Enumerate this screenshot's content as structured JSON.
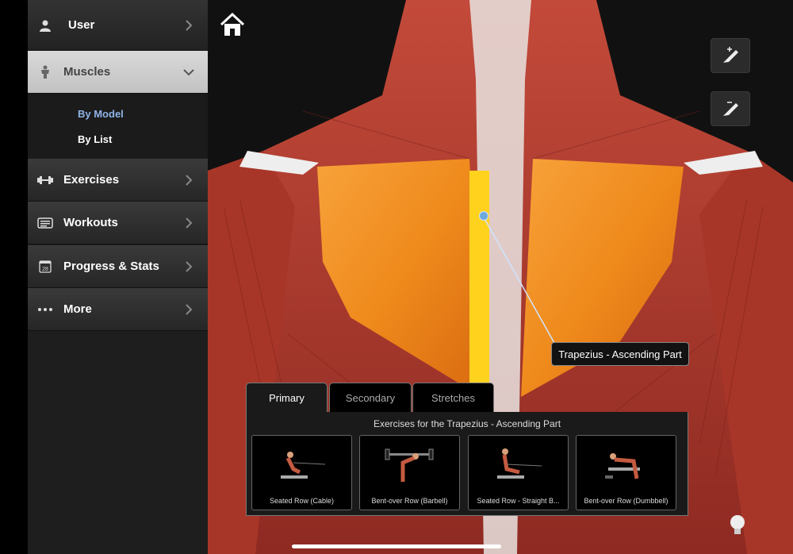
{
  "sidebar": {
    "items": [
      {
        "label": "User",
        "icon": "user-icon"
      },
      {
        "label": "Muscles",
        "icon": "muscle-figure-icon",
        "expanded": true
      },
      {
        "label": "Exercises",
        "icon": "dumbbell-icon"
      },
      {
        "label": "Workouts",
        "icon": "workout-card-icon"
      },
      {
        "label": "Progress & Stats",
        "icon": "calendar-icon"
      },
      {
        "label": "More",
        "icon": "ellipsis-icon"
      }
    ],
    "submenu": {
      "by_model": "By Model",
      "by_list": "By List",
      "selected": "By Model"
    },
    "calendar_day": "28"
  },
  "viewer": {
    "callout_label": "Trapezius - Ascending Part",
    "highlight_color": "#f08a1c",
    "tools": [
      "add-pen-icon",
      "remove-pen-icon"
    ]
  },
  "exercises_panel": {
    "tabs": [
      "Primary",
      "Secondary",
      "Stretches"
    ],
    "active_tab": "Primary",
    "title": "Exercises for the Trapezius - Ascending Part",
    "cards": [
      {
        "caption": "Seated Row (Cable)"
      },
      {
        "caption": "Bent-over Row (Barbell)"
      },
      {
        "caption": "Seated Row - Straight B..."
      },
      {
        "caption": "Bent-over Row (Dumbbell)"
      }
    ]
  },
  "colors": {
    "accent_blue": "#8fb4e8",
    "muscle_red": "#b5382c",
    "tendon_white": "#eaeaea"
  }
}
